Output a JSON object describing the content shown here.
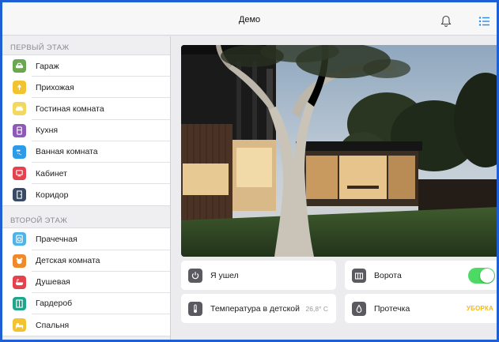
{
  "header": {
    "title": "Демо",
    "bell_icon": "bell-icon",
    "menu_icon": "list-icon"
  },
  "sidebar": {
    "sections": [
      {
        "title": "ПЕРВЫЙ ЭТАЖ",
        "items": [
          {
            "label": "Гараж",
            "icon": "car-icon",
            "color": "#6aa84f"
          },
          {
            "label": "Прихожая",
            "icon": "lamp-icon",
            "color": "#f2c230"
          },
          {
            "label": "Гостиная комната",
            "icon": "sofa-icon",
            "color": "#f2d85e"
          },
          {
            "label": "Кухня",
            "icon": "fridge-icon",
            "color": "#8e5ab8"
          },
          {
            "label": "Ванная комната",
            "icon": "shower-icon",
            "color": "#2e9be6"
          },
          {
            "label": "Кабинет",
            "icon": "desk-icon",
            "color": "#e5424d"
          },
          {
            "label": "Коридор",
            "icon": "door-icon",
            "color": "#3a4a63"
          }
        ]
      },
      {
        "title": "ВТОРОЙ ЭТАЖ",
        "items": [
          {
            "label": "Прачечная",
            "icon": "washer-icon",
            "color": "#4fb3e8"
          },
          {
            "label": "Детская комната",
            "icon": "toy-icon",
            "color": "#ef8a2c"
          },
          {
            "label": "Душевая",
            "icon": "bath-icon",
            "color": "#e5424d"
          },
          {
            "label": "Гардероб",
            "icon": "wardrobe-icon",
            "color": "#1fa58c"
          },
          {
            "label": "Спальня",
            "icon": "bed-icon",
            "color": "#f2c230"
          }
        ]
      }
    ]
  },
  "cards": {
    "away": {
      "label": "Я ушел",
      "icon": "power-icon"
    },
    "gate": {
      "label": "Ворота",
      "icon": "gate-icon",
      "toggle_on": true
    },
    "temp": {
      "label": "Температура в детской",
      "value": "26,8° C",
      "icon": "thermometer-icon"
    },
    "leak": {
      "label": "Протечка",
      "status": "УБОРКА",
      "icon": "drop-icon"
    }
  },
  "colors": {
    "accent": "#1e5fd6",
    "toggle_on": "#4cd964",
    "status_warning": "#f2b91e"
  }
}
